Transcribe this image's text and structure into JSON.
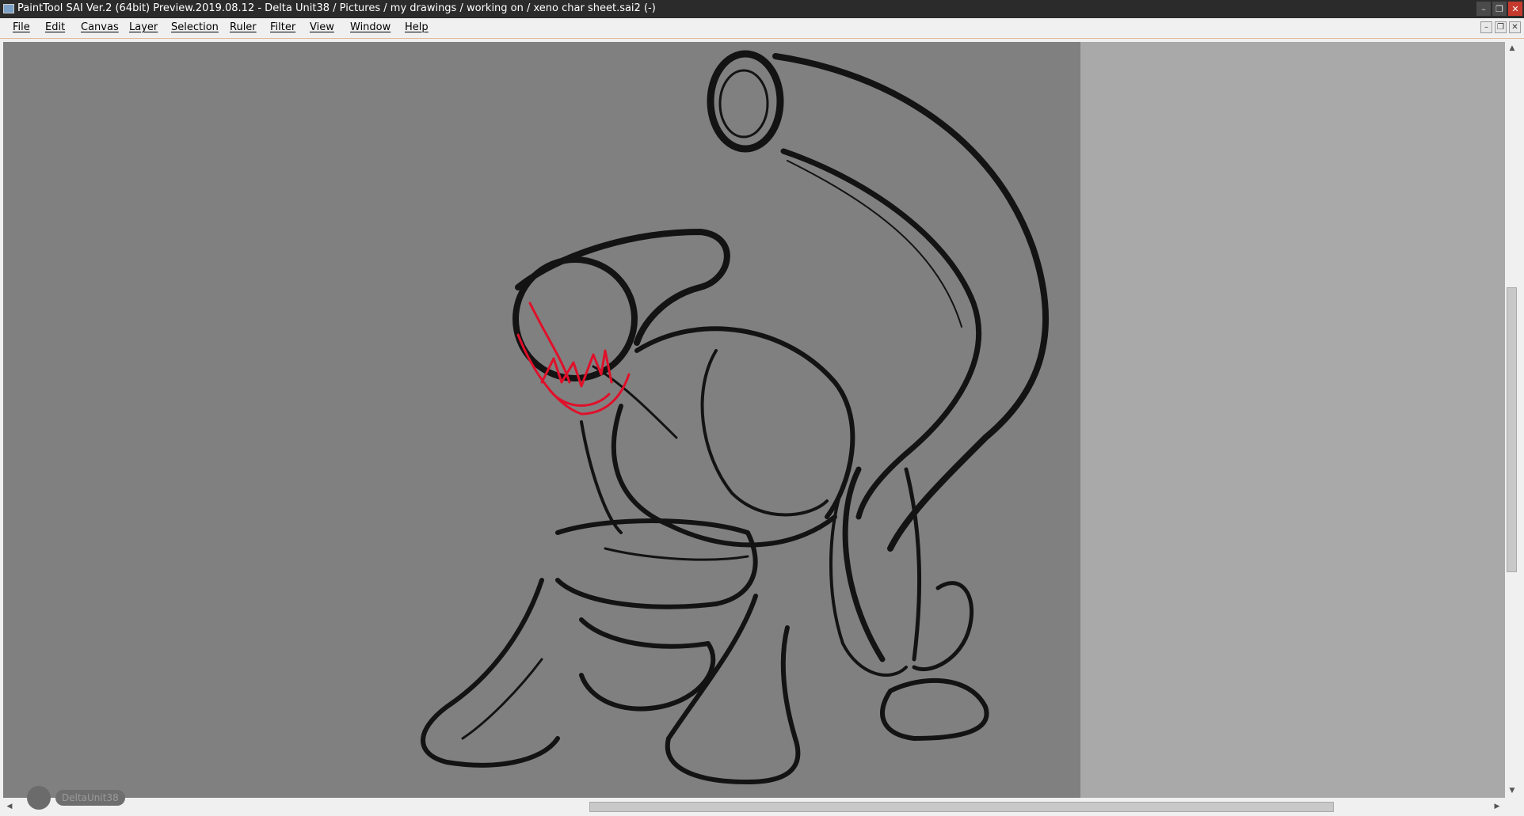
{
  "window": {
    "title": "PaintTool SAI Ver.2 (64bit) Preview.2019.08.12 - Delta Unit38 / Pictures / my drawings / working on / xeno char sheet.sai2 (-)",
    "buttons": {
      "minimize": "–",
      "restore": "❐",
      "close": "✕"
    }
  },
  "menu": [
    {
      "label": "File"
    },
    {
      "label": "Edit"
    },
    {
      "label": "Canvas"
    },
    {
      "label": "Layer"
    },
    {
      "label": "Selection"
    },
    {
      "label": "Ruler"
    },
    {
      "label": "Filter"
    },
    {
      "label": "View"
    },
    {
      "label": "Window"
    },
    {
      "label": "Help"
    }
  ],
  "mdi_buttons": {
    "minimize": "–",
    "restore": "❐",
    "close": "✕"
  },
  "watermark": {
    "name": "DeltaUnit38"
  },
  "colors": {
    "canvas": "#808080",
    "workspace": "#a9a9a9",
    "sketch": "#000000",
    "accent_stroke": "#e0102a",
    "titlebar": "#2b2b2b",
    "close": "#c63a2e"
  },
  "icons": {
    "app": "sai-app-icon",
    "scroll_up": "arrow-up-icon",
    "scroll_down": "arrow-down-icon",
    "scroll_left": "arrow-left-icon",
    "scroll_right": "arrow-right-icon"
  }
}
